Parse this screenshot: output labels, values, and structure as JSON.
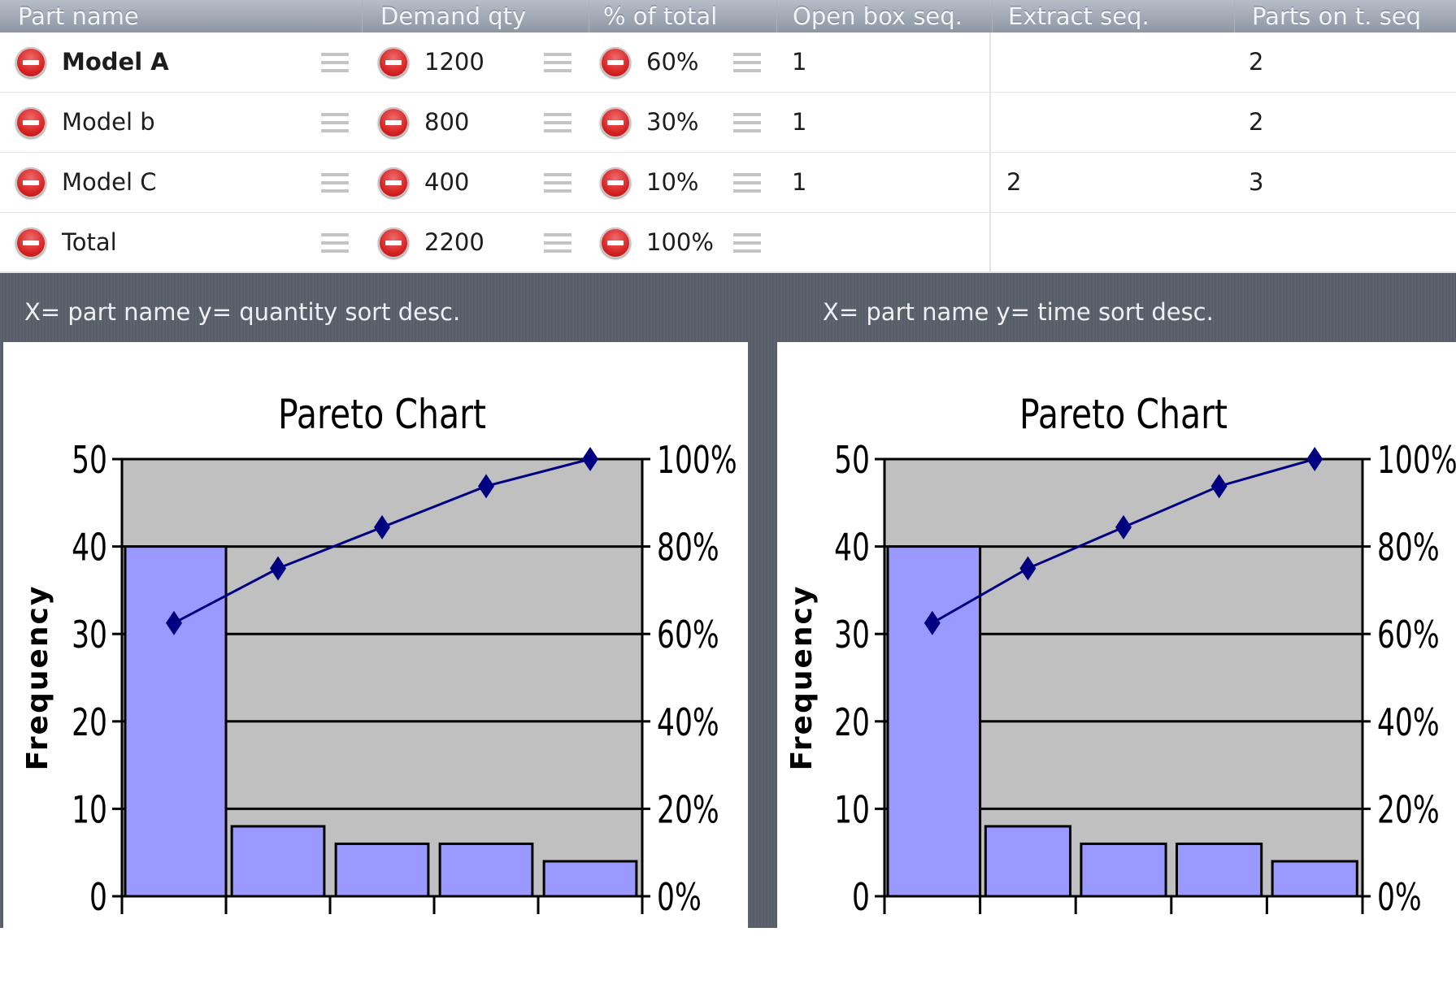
{
  "table": {
    "columns": [
      "Part name",
      "Demand qty",
      "% of total",
      "Open box seq.",
      "Extract seq.",
      "Parts on t. seq"
    ],
    "rows": [
      {
        "part": "Model A",
        "qty": "1200",
        "pct": "60%",
        "open_box": "1",
        "extract": "",
        "parts_on": "2"
      },
      {
        "part": "Model b",
        "qty": "800",
        "pct": "30%",
        "open_box": "1",
        "extract": "",
        "parts_on": "2"
      },
      {
        "part": "Model C",
        "qty": "400",
        "pct": "10%",
        "open_box": "1",
        "extract": "2",
        "parts_on": "3"
      },
      {
        "part": "Total",
        "qty": "2200",
        "pct": "100%",
        "open_box": "",
        "extract": "",
        "parts_on": ""
      }
    ]
  },
  "captions": {
    "left": "X= part name y= quantity sort desc.",
    "right": "X= part name y= time sort desc."
  },
  "colors": {
    "bar_fill": "#9999ff",
    "plot_bg": "#c0c0c0",
    "line": "#000080",
    "delete_red": "#d42020"
  },
  "chart_data": [
    {
      "type": "bar",
      "title": "Pareto Chart",
      "ylabel": "Frequency",
      "ylim": [
        0,
        50
      ],
      "y_ticks": [
        "0",
        "10",
        "20",
        "30",
        "40",
        "50"
      ],
      "y2lim": [
        0,
        100
      ],
      "y2_ticks": [
        "0%",
        "20%",
        "40%",
        "60%",
        "80%",
        "100%"
      ],
      "grid": true,
      "categories": [
        "",
        "",
        "",
        "",
        ""
      ],
      "values": [
        40,
        8,
        6,
        6,
        4
      ],
      "cumulative_pct": [
        62.5,
        75,
        84.4,
        93.8,
        100
      ]
    },
    {
      "type": "bar",
      "title": "Pareto Chart",
      "ylabel": "Frequency",
      "ylim": [
        0,
        50
      ],
      "y_ticks": [
        "0",
        "10",
        "20",
        "30",
        "40",
        "50"
      ],
      "y2lim": [
        0,
        100
      ],
      "y2_ticks": [
        "0%",
        "20%",
        "40%",
        "60%",
        "80%",
        "100%"
      ],
      "grid": true,
      "categories": [
        "",
        "",
        "",
        "",
        ""
      ],
      "values": [
        40,
        8,
        6,
        6,
        4
      ],
      "cumulative_pct": [
        62.5,
        75,
        84.4,
        93.8,
        100
      ]
    }
  ]
}
